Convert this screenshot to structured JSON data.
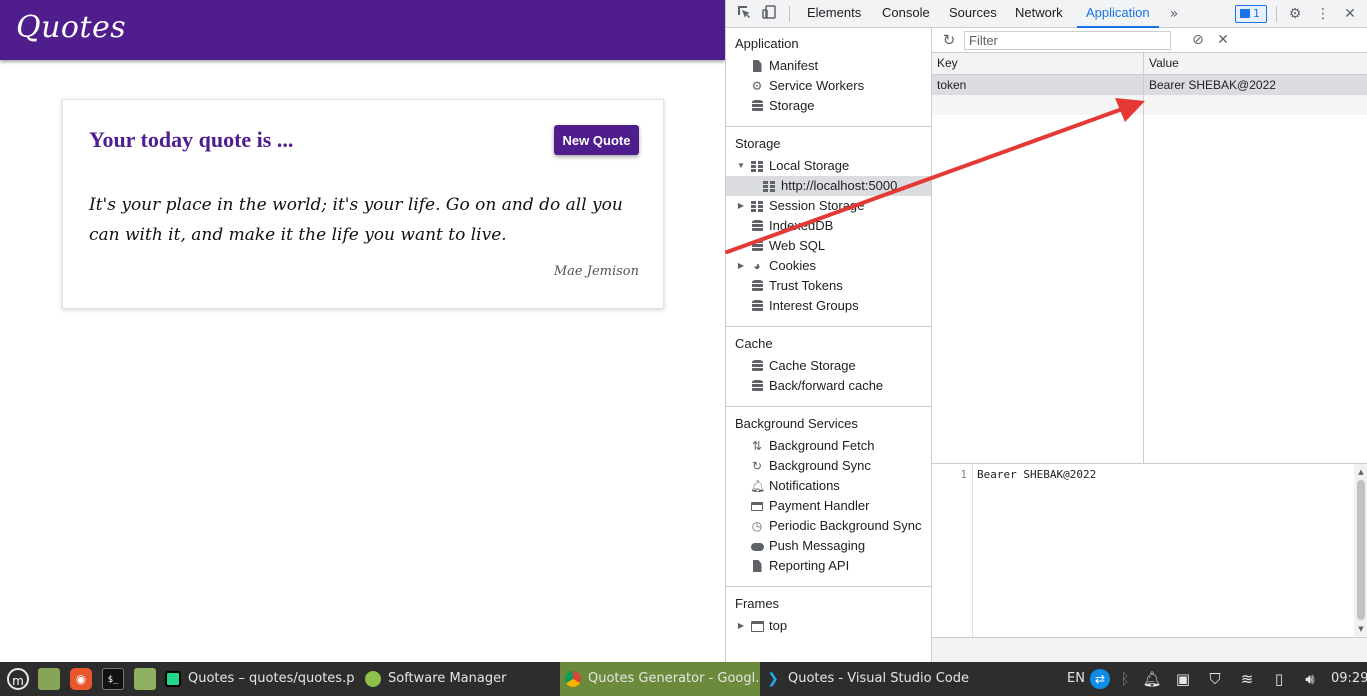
{
  "page": {
    "brand": "Quotes",
    "card": {
      "title": "Your today quote is ...",
      "new_quote_label": "New Quote",
      "quote": "It's your place in the world; it's your life. Go on and do all you can with it, and make it the life you want to live.",
      "author": "Mae Jemison"
    }
  },
  "devtools": {
    "tabs": [
      {
        "label": "Elements"
      },
      {
        "label": "Console"
      },
      {
        "label": "Sources"
      },
      {
        "label": "Network"
      },
      {
        "label": "Application"
      }
    ],
    "issues_count": "1",
    "sidebar": {
      "application": {
        "title": "Application",
        "items": [
          "Manifest",
          "Service Workers",
          "Storage"
        ]
      },
      "storage": {
        "title": "Storage",
        "local_storage": "Local Storage",
        "local_origin": "http://localhost:5000",
        "items": [
          "Session Storage",
          "IndexedDB",
          "Web SQL",
          "Cookies",
          "Trust Tokens",
          "Interest Groups"
        ]
      },
      "cache": {
        "title": "Cache",
        "items": [
          "Cache Storage",
          "Back/forward cache"
        ]
      },
      "background": {
        "title": "Background Services",
        "items": [
          "Background Fetch",
          "Background Sync",
          "Notifications",
          "Payment Handler",
          "Periodic Background Sync",
          "Push Messaging",
          "Reporting API"
        ]
      },
      "frames": {
        "title": "Frames",
        "top": "top"
      }
    },
    "filter_placeholder": "Filter",
    "table": {
      "headers": {
        "key": "Key",
        "value": "Value"
      },
      "rows": [
        {
          "key": "token",
          "value": "Bearer SHEBAK@2022"
        }
      ]
    },
    "preview": {
      "line_number": "1",
      "text": "Bearer SHEBAK@2022"
    },
    "colors": {
      "accent": "#1a73e8",
      "annotation_arrow": "#e53935"
    }
  },
  "taskbar": {
    "tasks": [
      {
        "label": "Quotes – quotes/quotes.py",
        "icon": "pycharm-icon"
      },
      {
        "label": "Software Manager",
        "icon": "software-manager-icon"
      },
      {
        "label": "Quotes Generator - Googl...",
        "icon": "chrome-icon"
      },
      {
        "label": "Quotes - Visual Studio Code",
        "icon": "vscode-icon"
      }
    ],
    "lang": "EN",
    "clock": "09:29",
    "colors": {
      "bar": "#2d2d2d",
      "active_task": "#6b8a3c",
      "brand_purple": "#4f1d8c"
    }
  }
}
